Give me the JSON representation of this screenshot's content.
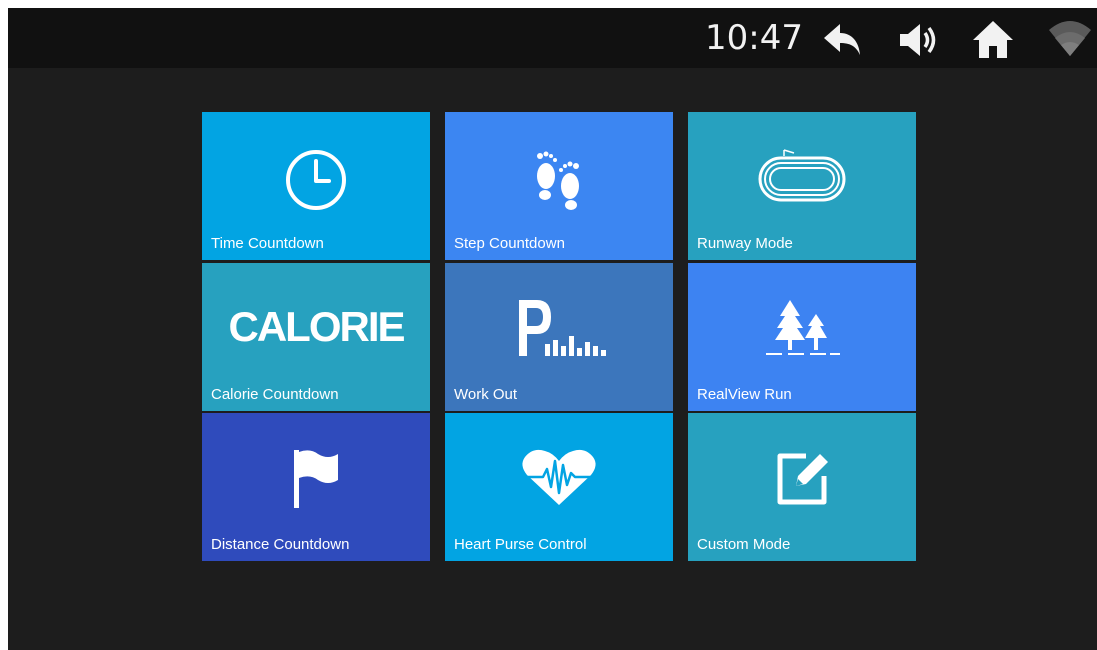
{
  "status_bar": {
    "time": "10:47",
    "icons": [
      "back-icon",
      "volume-icon",
      "home-icon",
      "wifi-icon"
    ]
  },
  "tiles": [
    {
      "label": "Time Countdown",
      "icon": "clock-icon",
      "color": "#02a4e3"
    },
    {
      "label": "Step Countdown",
      "icon": "footprints-icon",
      "color": "#3c86f2"
    },
    {
      "label": "Runway Mode",
      "icon": "running-track-icon",
      "color": "#27a1bf"
    },
    {
      "label": "Calorie Countdown",
      "icon": "calorie-text-icon",
      "icon_text": "CALORIE",
      "color": "#27a1bf"
    },
    {
      "label": "Work Out",
      "icon": "program-chart-icon",
      "color": "#3c76bc"
    },
    {
      "label": "RealView Run",
      "icon": "trees-icon",
      "color": "#3d83f2"
    },
    {
      "label": "Distance Countdown",
      "icon": "flag-icon",
      "color": "#2f4bbc"
    },
    {
      "label": "Heart Purse Control",
      "icon": "heart-pulse-icon",
      "color": "#02a4e3"
    },
    {
      "label": "Custom Mode",
      "icon": "edit-icon",
      "color": "#27a1bf"
    }
  ],
  "colors": {
    "screen_background": "#1d1d1d",
    "status_bar_background": "#111111"
  }
}
